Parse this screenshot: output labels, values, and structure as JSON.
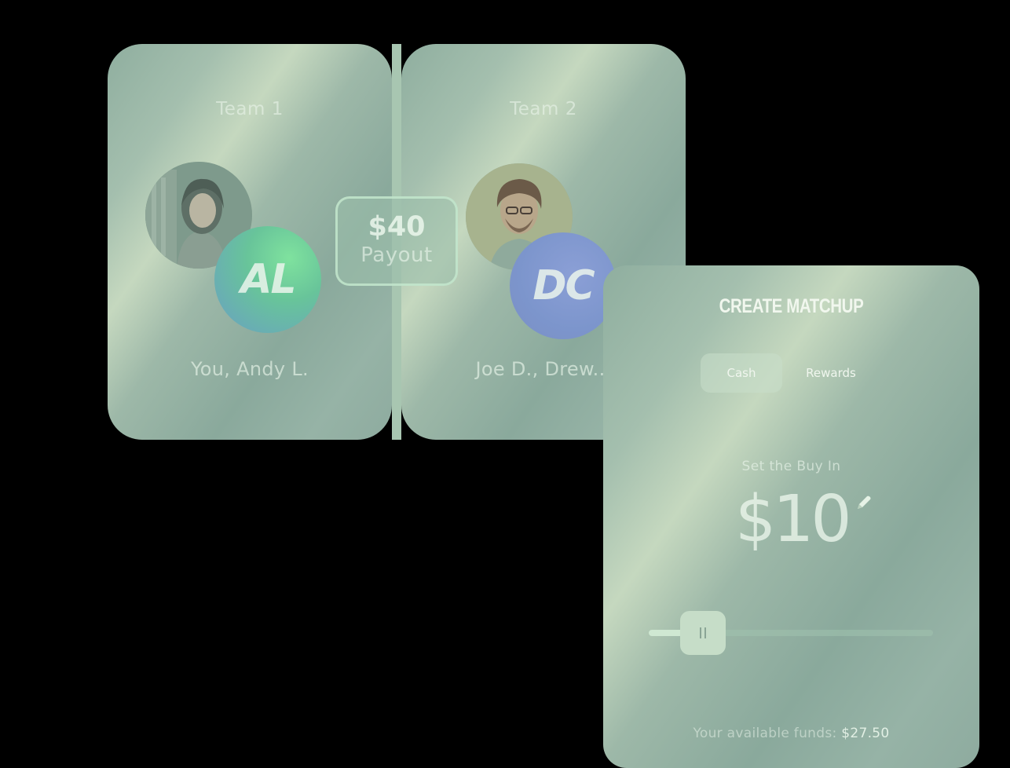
{
  "matchup": {
    "team1": {
      "title": "Team 1",
      "members": "You, Andy L.",
      "avatar_initials": "AL"
    },
    "team2": {
      "title": "Team 2",
      "members": "Joe D., Drew...",
      "avatar_initials": "DC"
    },
    "payout": {
      "amount": "$40",
      "label": "Payout"
    }
  },
  "create": {
    "title": "CREATE MATCHUP",
    "tabs": [
      {
        "label": "Cash",
        "selected": true
      },
      {
        "label": "Rewards",
        "selected": false
      }
    ],
    "buyin_label": "Set the Buy In",
    "buyin_value": "$10",
    "slider_fraction": 0.19,
    "funds_label": "Your available funds:",
    "funds_amount": "$27.50"
  },
  "icons": {
    "edit": "pencil-icon",
    "slider_handle": "grip-icon"
  },
  "colors": {
    "accent_green": "#7fe29e",
    "accent_blue": "#7c95cc"
  }
}
